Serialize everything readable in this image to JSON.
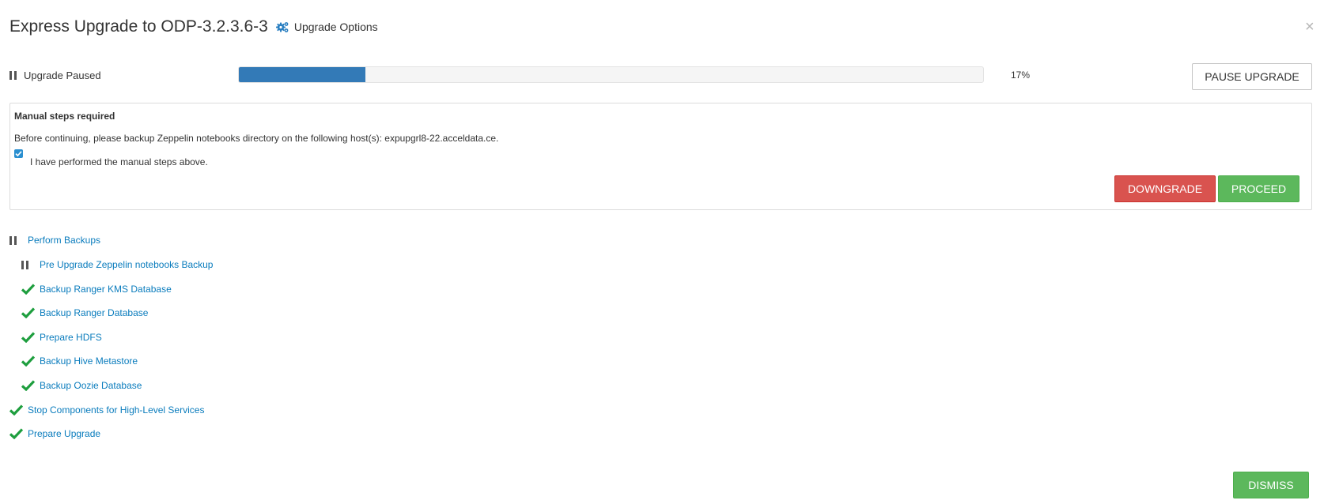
{
  "header": {
    "title": "Express Upgrade to ODP-3.2.3.6-3",
    "options_label": "Upgrade Options",
    "options_icon": "gears-icon",
    "close_symbol": "×"
  },
  "status": {
    "label": "Upgrade Paused",
    "progress_percent": 17,
    "progress_text": "17%",
    "pause_button_label": "PAUSE UPGRADE"
  },
  "manual_steps": {
    "title": "Manual steps required",
    "message": "Before continuing, please backup Zeppelin notebooks directory on the following host(s): expupgrl8-22.acceldata.ce.",
    "confirm_label": "I have performed the manual steps above.",
    "confirmed": true,
    "downgrade_label": "DOWNGRADE",
    "proceed_label": "PROCEED"
  },
  "tasks": [
    {
      "label": "Perform Backups",
      "status": "paused",
      "level": 0
    },
    {
      "label": "Pre Upgrade Zeppelin notebooks Backup",
      "status": "paused",
      "level": 1
    },
    {
      "label": "Backup Ranger KMS Database",
      "status": "completed",
      "level": 1
    },
    {
      "label": "Backup Ranger Database",
      "status": "completed",
      "level": 1
    },
    {
      "label": "Prepare HDFS",
      "status": "completed",
      "level": 1
    },
    {
      "label": "Backup Hive Metastore",
      "status": "completed",
      "level": 1
    },
    {
      "label": "Backup Oozie Database",
      "status": "completed",
      "level": 1
    },
    {
      "label": "Stop Components for High-Level Services",
      "status": "completed",
      "level": 0
    },
    {
      "label": "Prepare Upgrade",
      "status": "completed",
      "level": 0
    }
  ],
  "footer": {
    "dismiss_label": "DISMISS"
  },
  "colors": {
    "progress_fill": "#337ab7",
    "link": "#0a7cbd",
    "success": "#5cb85c",
    "danger": "#d9534f",
    "check": "#1e9e3e"
  }
}
